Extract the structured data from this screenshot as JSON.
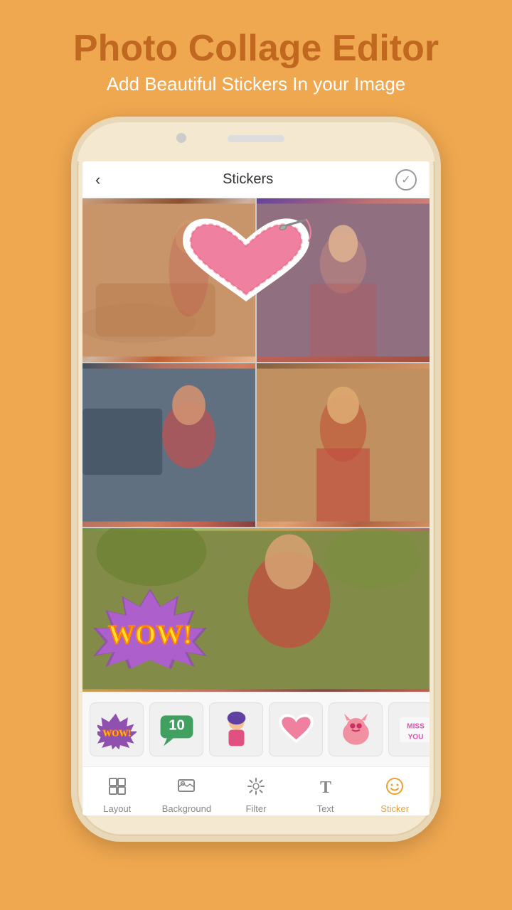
{
  "header": {
    "title": "Photo Collage Editor",
    "subtitle": "Add Beautiful Stickers In your Image"
  },
  "phone": {
    "topbar": {
      "back_label": "‹",
      "title": "Stickers",
      "check_icon": "✓"
    },
    "sticker_thumbs": [
      {
        "id": "wow",
        "emoji": "💥"
      },
      {
        "id": "chat",
        "emoji": "💬"
      },
      {
        "id": "girl",
        "emoji": "👧"
      },
      {
        "id": "heart-sew",
        "emoji": "🧵"
      },
      {
        "id": "cat",
        "emoji": "🐱"
      },
      {
        "id": "miss-you",
        "emoji": "💌"
      }
    ],
    "nav": {
      "items": [
        {
          "id": "layout",
          "label": "Layout",
          "icon": "layout",
          "active": false
        },
        {
          "id": "background",
          "label": "Background",
          "icon": "background",
          "active": false
        },
        {
          "id": "filter",
          "label": "Filter",
          "icon": "filter",
          "active": false
        },
        {
          "id": "text",
          "label": "Text",
          "icon": "text",
          "active": false
        },
        {
          "id": "sticker",
          "label": "Sticker",
          "icon": "sticker",
          "active": true
        }
      ]
    }
  },
  "colors": {
    "background": "#F0A850",
    "accent": "#F0A030",
    "title": "#C06820"
  }
}
